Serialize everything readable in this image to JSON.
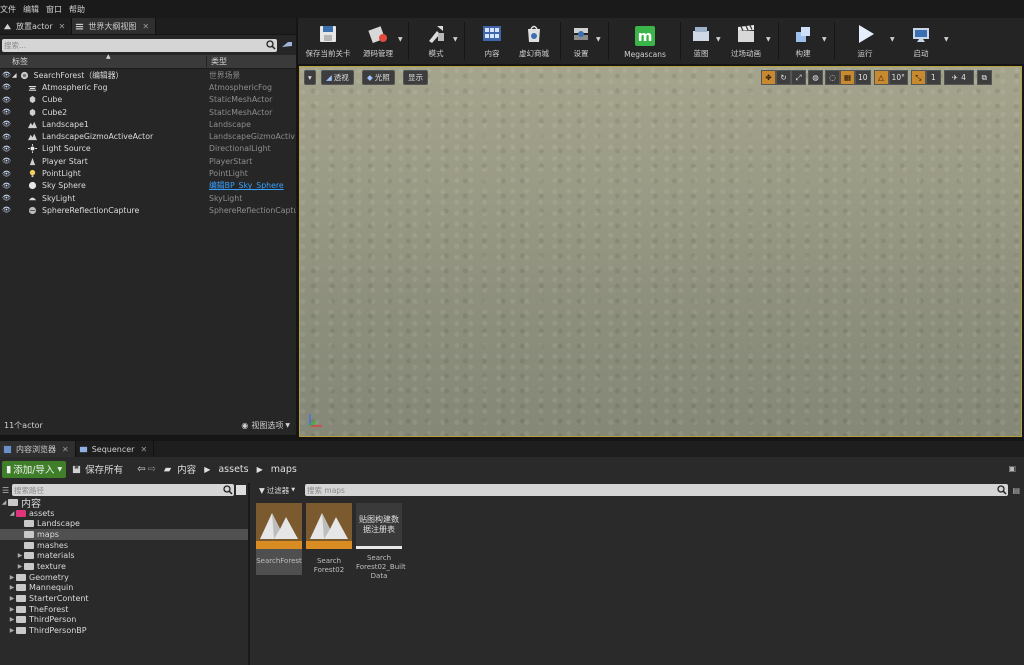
{
  "menu": [
    "文件",
    "编辑",
    "窗口",
    "帮助"
  ],
  "top_tabs": [
    {
      "label": "放置actor",
      "active": false
    },
    {
      "label": "世界大纲视图",
      "active": true
    }
  ],
  "outliner": {
    "search_placeholder": "搜索...",
    "col_label": "标签",
    "col_type": "类型",
    "rows": [
      {
        "name": "SearchForest（编辑器）",
        "type": "世界场景",
        "icon": "world-icon"
      },
      {
        "name": "Atmospheric Fog",
        "type": "AtmosphericFog",
        "icon": "fog-icon"
      },
      {
        "name": "Cube",
        "type": "StaticMeshActor",
        "icon": "mesh-icon"
      },
      {
        "name": "Cube2",
        "type": "StaticMeshActor",
        "icon": "mesh-icon"
      },
      {
        "name": "Landscape1",
        "type": "Landscape",
        "icon": "landscape-icon"
      },
      {
        "name": "LandscapeGizmoActiveActor",
        "type": "LandscapeGizmoActiv",
        "icon": "landscape-icon"
      },
      {
        "name": "Light Source",
        "type": "DirectionalLight",
        "icon": "sun-icon"
      },
      {
        "name": "Player Start",
        "type": "PlayerStart",
        "icon": "player-start-icon"
      },
      {
        "name": "PointLight",
        "type": "PointLight",
        "icon": "bulb-icon"
      },
      {
        "name": "Sky Sphere",
        "type": "编辑BP_Sky_Sphere",
        "icon": "sphere-icon",
        "link": true
      },
      {
        "name": "SkyLight",
        "type": "SkyLight",
        "icon": "skylight-icon"
      },
      {
        "name": "SphereReflectionCapture",
        "type": "SphereReflectionCaptu",
        "icon": "reflection-icon"
      }
    ],
    "count": "11个actor",
    "view_options": "视图选项"
  },
  "toolbar": {
    "items": [
      {
        "label": "保存当前关卡",
        "icon": "save-icon"
      },
      {
        "label": "源码管理",
        "icon": "source-control-icon"
      },
      {
        "label": "模式",
        "icon": "modes-icon"
      },
      {
        "label": "内容",
        "icon": "content-icon"
      },
      {
        "label": "虚幻商城",
        "icon": "marketplace-icon"
      },
      {
        "label": "设置",
        "icon": "settings-icon"
      },
      {
        "label": "Megascans",
        "icon": "megascans-icon"
      },
      {
        "label": "蓝图",
        "icon": "blueprint-icon"
      },
      {
        "label": "过场动画",
        "icon": "cinematics-icon"
      },
      {
        "label": "构建",
        "icon": "build-icon"
      },
      {
        "label": "运行",
        "icon": "play-icon"
      },
      {
        "label": "启动",
        "icon": "launch-icon"
      }
    ]
  },
  "viewport": {
    "perspective": "透视",
    "lit": "光照",
    "show": "显示",
    "grid_snap": "10",
    "rotation_snap": "10°",
    "scale_snap": "1",
    "camera_speed": "4"
  },
  "bottom_tabs": [
    {
      "label": "内容浏览器",
      "active": true
    },
    {
      "label": "Sequencer",
      "active": false
    }
  ],
  "content_browser": {
    "add_import": "添加/导入",
    "save_all": "保存所有",
    "breadcrumb": [
      "内容",
      "assets",
      "maps"
    ],
    "path_search_placeholder": "搜索路径",
    "filters": "过滤器",
    "asset_search_placeholder": "搜索 maps",
    "tree": [
      {
        "label": "内容",
        "depth": 0,
        "expanded": true
      },
      {
        "label": "assets",
        "depth": 1,
        "expanded": true,
        "pink": true
      },
      {
        "label": "Landscape",
        "depth": 2
      },
      {
        "label": "maps",
        "depth": 2,
        "selected": true
      },
      {
        "label": "mashes",
        "depth": 2
      },
      {
        "label": "materials",
        "depth": 2,
        "collapsed": true
      },
      {
        "label": "texture",
        "depth": 2,
        "collapsed": true
      },
      {
        "label": "Geometry",
        "depth": 1,
        "collapsed": true
      },
      {
        "label": "Mannequin",
        "depth": 1,
        "collapsed": true
      },
      {
        "label": "StarterContent",
        "depth": 1,
        "collapsed": true
      },
      {
        "label": "TheForest",
        "depth": 1,
        "collapsed": true
      },
      {
        "label": "ThirdPerson",
        "depth": 1,
        "collapsed": true
      },
      {
        "label": "ThirdPersonBP",
        "depth": 1,
        "collapsed": true
      }
    ],
    "assets": [
      {
        "label": "SearchForest",
        "kind": "level",
        "selected": true
      },
      {
        "label": "Search Forest02",
        "kind": "level"
      },
      {
        "label": "Search Forest02_Built Data",
        "kind": "registry",
        "thumb_text": "贴图构建数据注册表"
      }
    ]
  }
}
